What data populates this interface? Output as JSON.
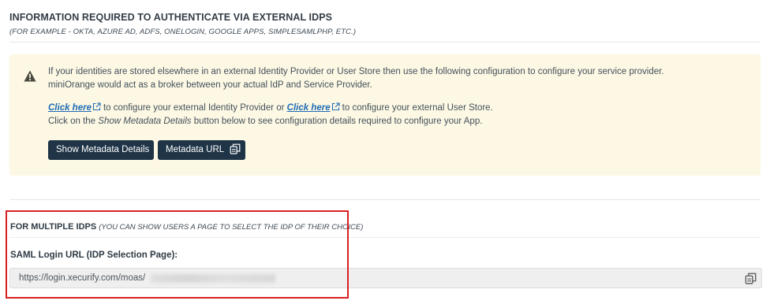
{
  "section": {
    "title": "INFORMATION REQUIRED TO AUTHENTICATE VIA EXTERNAL IDPS",
    "subtitle": "(FOR EXAMPLE - OKTA, AZURE AD, ADFS, ONELOGIN, GOOGLE APPS, SIMPLESAMLPHP, ETC.)"
  },
  "alert": {
    "icon": "warning-icon",
    "line1": "If your identities are stored elsewhere in an external Identity Provider or User Store then use the following configuration to configure your service provider.",
    "line2": "miniOrange would act as a broker between your actual IdP and Service Provider.",
    "link1_label": "Click here",
    "link1_suffix": "to configure your external Identity Provider or",
    "link2_label": "Click here",
    "link2_suffix": "to configure your external User Store.",
    "line4_prefix": "Click on the ",
    "line4_emphasis": "Show Metadata Details",
    "line4_suffix": " button below to see configuration details required to configure your App.",
    "button_show": "Show Metadata Details",
    "button_meta": "Metadata URL"
  },
  "multiple": {
    "title": "FOR MULTIPLE IDPS",
    "hint": "(YOU CAN SHOW USERS A PAGE TO SELECT THE IDP OF THEIR CHOICE)",
    "url_label": "SAML Login URL (IDP Selection Page):",
    "url_value": "https://login.xecurify.com/moas/"
  },
  "colors": {
    "alert_bg": "#fcf8e4",
    "button_bg": "#1f3447",
    "link": "#1f6bb3",
    "highlight": "#d92020"
  }
}
